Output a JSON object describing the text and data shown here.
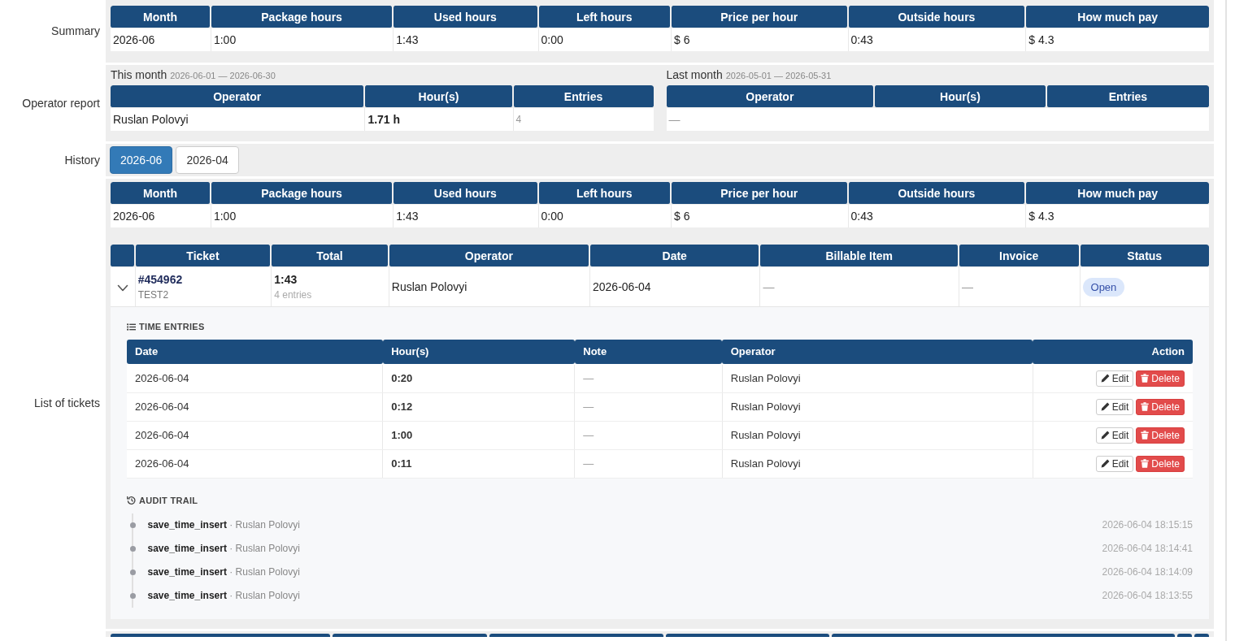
{
  "sections": [
    {
      "kind": "summary",
      "label": "Summary",
      "table": {
        "columns": [
          "Month",
          "Package hours",
          "Used hours",
          "Left hours",
          "Price per hour",
          "Outside hours",
          "How much pay"
        ],
        "rows": [
          [
            "2026-06",
            "1:00",
            "1:43",
            "0:00",
            "$ 6",
            "0:43",
            "$ 4.3"
          ]
        ]
      }
    },
    {
      "kind": "operator_report",
      "label": "Operator report",
      "panels": [
        {
          "title": "This month",
          "range": "2026-06-01 — 2026-06-30",
          "columns": [
            "Operator",
            "Hour(s)",
            "Entries"
          ],
          "rows": [
            {
              "operator": "Ruslan Polovyi",
              "hours": "1.71 h",
              "entries": "4"
            }
          ]
        },
        {
          "title": "Last month",
          "range": "2026-05-01 — 2026-05-31",
          "columns": [
            "Operator",
            "Hour(s)",
            "Entries"
          ],
          "empty_text": "—"
        }
      ]
    },
    {
      "kind": "history",
      "label": "History",
      "months": [
        {
          "label": "2026-06",
          "selected": true
        },
        {
          "label": "2026-04",
          "selected": false
        }
      ]
    },
    {
      "kind": "tickets",
      "label": "List of tickets",
      "summary_table": {
        "columns": [
          "Month",
          "Package hours",
          "Used hours",
          "Left hours",
          "Price per hour",
          "Outside hours",
          "How much pay"
        ],
        "rows": [
          [
            "2026-06",
            "1:00",
            "1:43",
            "0:00",
            "$ 6",
            "0:43",
            "$ 4.3"
          ]
        ]
      },
      "tickets_table": {
        "columns": [
          "Ticket",
          "Total",
          "Operator",
          "Date",
          "Billable Item",
          "Invoice",
          "Status"
        ],
        "rows": [
          {
            "ticket": "#454962",
            "subject": "TEST2",
            "total": "1:43",
            "entries": "4 entries",
            "operator": "Ruslan Polovyi",
            "date": "2026-06-04",
            "billable_item": "—",
            "invoice": "—",
            "status": "Open",
            "expanded": true,
            "time_entries": {
              "title": "TIME ENTRIES",
              "columns": [
                "Date",
                "Hour(s)",
                "Note",
                "Operator",
                "Action"
              ],
              "rows": [
                {
                  "date": "2026-06-04",
                  "hours": "0:20",
                  "note": "—",
                  "operator": "Ruslan Polovyi",
                  "actions": [
                    {
                      "kind": "edit",
                      "label": "Edit"
                    },
                    {
                      "kind": "delete",
                      "label": "Delete"
                    }
                  ]
                },
                {
                  "date": "2026-06-04",
                  "hours": "0:12",
                  "note": "—",
                  "operator": "Ruslan Polovyi",
                  "actions": [
                    {
                      "kind": "edit",
                      "label": "Edit"
                    },
                    {
                      "kind": "delete",
                      "label": "Delete"
                    }
                  ]
                },
                {
                  "date": "2026-06-04",
                  "hours": "1:00",
                  "note": "—",
                  "operator": "Ruslan Polovyi",
                  "actions": [
                    {
                      "kind": "edit",
                      "label": "Edit"
                    },
                    {
                      "kind": "delete",
                      "label": "Delete"
                    }
                  ]
                },
                {
                  "date": "2026-06-04",
                  "hours": "0:11",
                  "note": "—",
                  "operator": "Ruslan Polovyi",
                  "actions": [
                    {
                      "kind": "edit",
                      "label": "Edit"
                    },
                    {
                      "kind": "delete",
                      "label": "Delete"
                    }
                  ]
                }
              ]
            },
            "audit_trail": {
              "title": "AUDIT TRAIL",
              "items": [
                {
                  "text": "**save_time_insert** · Ruslan Polovyi",
                  "time": "2026-06-04 18:15:15"
                },
                {
                  "text": "**save_time_insert** · Ruslan Polovyi",
                  "time": "2026-06-04 18:14:41"
                },
                {
                  "text": "**save_time_insert** · Ruslan Polovyi",
                  "time": "2026-06-04 18:14:09"
                },
                {
                  "text": "**save_time_insert** · Ruslan Polovyi",
                  "time": "2026-06-04 18:13:55"
                }
              ]
            }
          }
        ]
      }
    },
    {
      "kind": "cut_off_table"
    }
  ]
}
